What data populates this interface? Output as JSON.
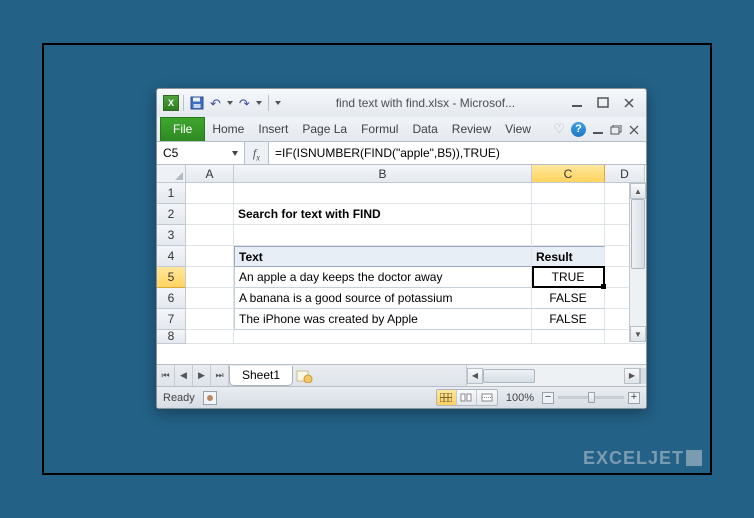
{
  "window": {
    "title": "find text with find.xlsx  -  Microsof..."
  },
  "ribbon": {
    "file": "File",
    "tabs": [
      "Home",
      "Insert",
      "Page La",
      "Formul",
      "Data",
      "Review",
      "View"
    ]
  },
  "formula_bar": {
    "namebox": "C5",
    "fx_label": "fx",
    "formula": "=IF(ISNUMBER(FIND(\"apple\",B5)),TRUE)"
  },
  "columns": [
    "A",
    "B",
    "C",
    "D"
  ],
  "row_numbers": [
    "1",
    "2",
    "3",
    "4",
    "5",
    "6",
    "7",
    "8"
  ],
  "b2": "Search for text with FIND",
  "headers": {
    "text": "Text",
    "result": "Result"
  },
  "data_rows": [
    {
      "text": "An apple a day keeps the doctor away",
      "result": "TRUE"
    },
    {
      "text": "A banana is a good source of potassium",
      "result": "FALSE"
    },
    {
      "text": "The iPhone was created by Apple",
      "result": "FALSE"
    }
  ],
  "sheet_tab": "Sheet1",
  "status": {
    "ready": "Ready",
    "zoom": "100%"
  },
  "active_cell": "C5",
  "watermark": "EXCELJET"
}
